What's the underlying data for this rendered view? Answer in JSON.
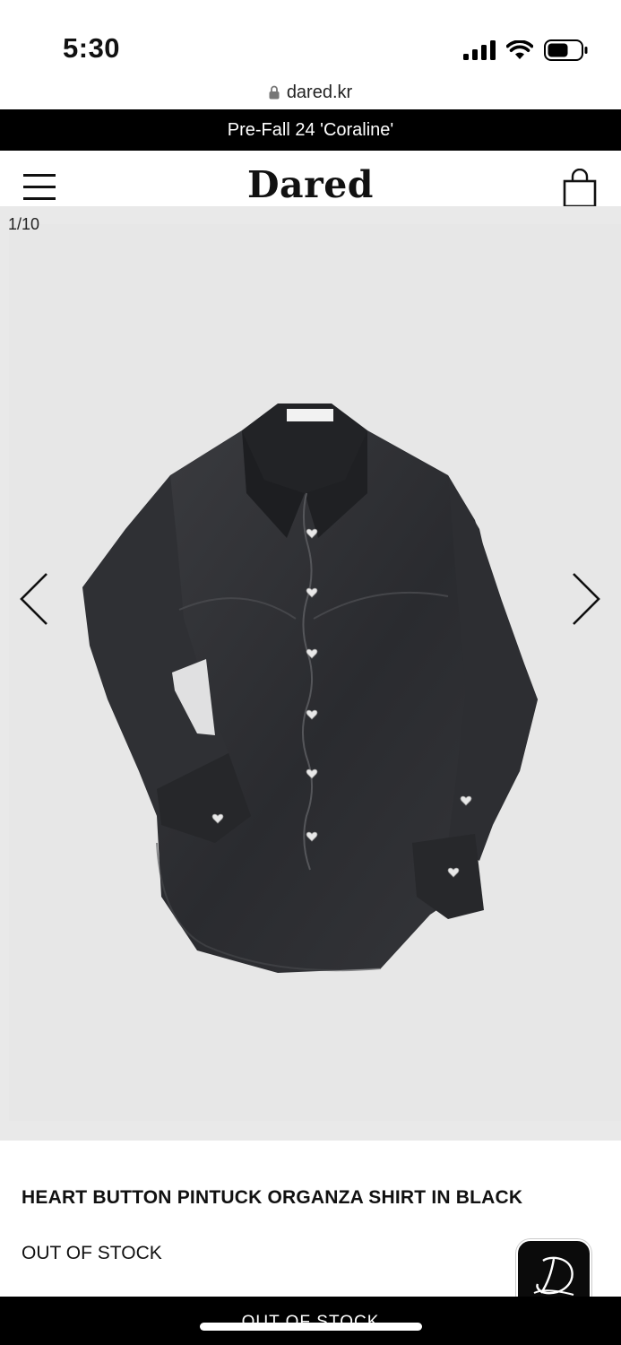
{
  "status_bar": {
    "time": "5:30",
    "icons": [
      "cellular-signal-icon",
      "wifi-icon",
      "battery-icon"
    ]
  },
  "browser": {
    "url": "dared.kr",
    "lock_icon": "lock-icon"
  },
  "announcement": {
    "text": "Pre-Fall 24 'Coraline'"
  },
  "header": {
    "logo": "Dared",
    "menu_icon": "hamburger-menu-icon",
    "cart_icon": "shopping-bag-icon"
  },
  "gallery": {
    "counter": "1/10",
    "prev_icon": "chevron-left-icon",
    "next_icon": "chevron-right-icon",
    "background_color": "#e8e8e8"
  },
  "product": {
    "title": "HEART BUTTON PINTUCK ORGANZA SHIRT IN BLACK",
    "stock_status": "OUT OF STOCK"
  },
  "footer": {
    "cta_label": "OUT OF STOCK"
  },
  "colors": {
    "accent": "#000000",
    "text": "#111111",
    "gallery_bg": "#e8e8e8"
  }
}
